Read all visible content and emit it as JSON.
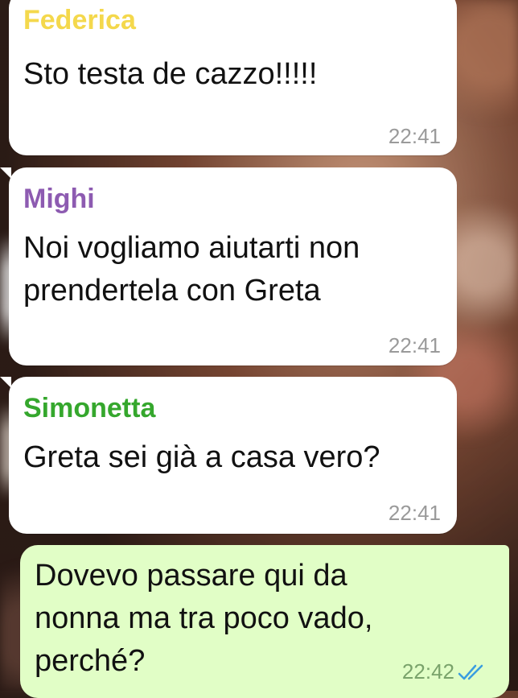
{
  "colors": {
    "federica": "#f4d84c",
    "mighi": "#8d5bb1",
    "simonetta": "#35a72d",
    "read_ticks": "#3a9de0",
    "incoming_bubble": "#ffffff",
    "outgoing_bubble": "#e1fec6"
  },
  "messages": [
    {
      "sender": "Federica",
      "text": "Sto testa de cazzo!!!!!",
      "time": "22:41"
    },
    {
      "sender": "Mighi",
      "text": "Noi vogliamo aiutarti non\nprendertela con Greta",
      "time": "22:41"
    },
    {
      "sender": "Simonetta",
      "text": "Greta sei già a casa vero?",
      "time": "22:41"
    },
    {
      "text": "Dovevo passare qui da\nnonna ma tra poco vado,\nperché?",
      "time": "22:42",
      "status_icon": "double-check-read-icon"
    }
  ]
}
